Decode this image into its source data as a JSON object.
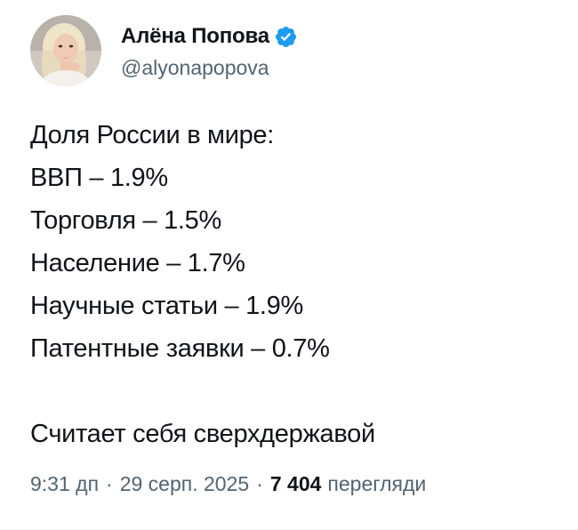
{
  "author": {
    "display_name": "Алёна Попова",
    "handle": "@alyonapopova",
    "verified_icon": "verified-badge-icon",
    "verified_color": "#1d9bf0"
  },
  "tweet": {
    "lines": [
      "Доля России в мире:",
      "ВВП – 1.9%",
      "Торговля – 1.5%",
      "Население – 1.7%",
      "Научные статьи – 1.9%",
      "Патентные заявки – 0.7%",
      "",
      "Считает себя сверхдержавой"
    ]
  },
  "meta": {
    "time": "9:31 дп",
    "separator": "·",
    "date": "29 серп. 2025",
    "views_count": "7 404",
    "views_label": "перегляди"
  }
}
